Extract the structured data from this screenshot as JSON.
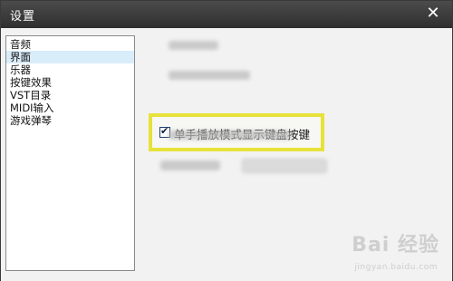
{
  "window": {
    "title": "设置",
    "close_glyph": "✕"
  },
  "sidebar": {
    "items": [
      {
        "label": "音频",
        "selected": false
      },
      {
        "label": "界面",
        "selected": true
      },
      {
        "label": "乐器",
        "selected": false
      },
      {
        "label": "按键效果",
        "selected": false
      },
      {
        "label": "VST目录",
        "selected": false
      },
      {
        "label": "MIDI输入",
        "selected": false
      },
      {
        "label": "游戏弹琴",
        "selected": false
      }
    ]
  },
  "panel": {
    "highlighted_option": {
      "label": "单手播放模式显示键盘按键",
      "checked": true,
      "highlight_color": "#e6e23a"
    }
  },
  "watermark": {
    "brand": "Bai 经验",
    "url": "jingyan.baidu.com"
  }
}
